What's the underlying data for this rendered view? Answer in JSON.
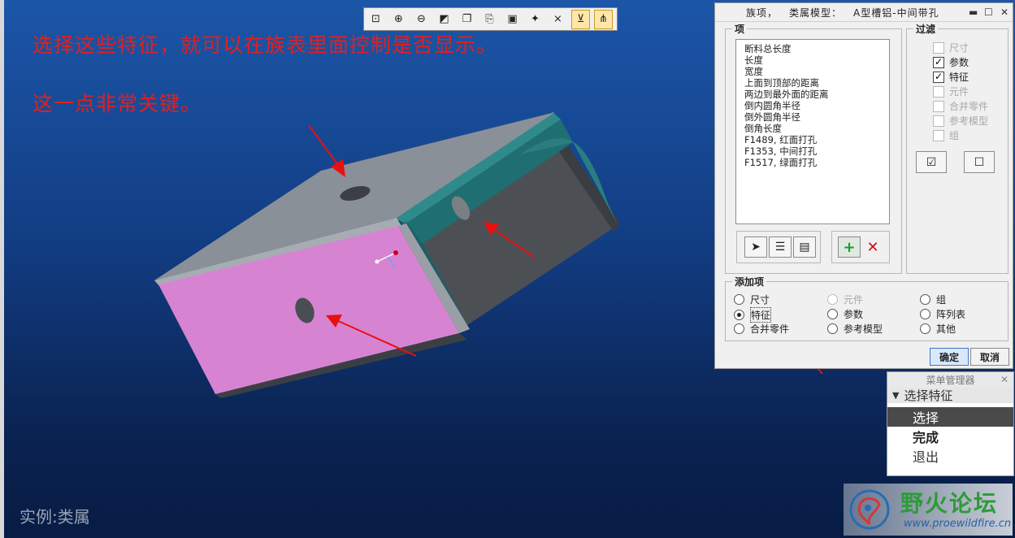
{
  "captions": {
    "line1": "选择这些特征，就可以在族表里面控制是否显示。",
    "line2": "这一点非常关键。",
    "instance_label": "实例:类属"
  },
  "toolbar": {
    "icons": [
      "zoom-fit-icon",
      "zoom-in-icon",
      "zoom-out-icon",
      "repaint-icon",
      "orientation-icon",
      "saved-views-icon",
      "layers-icon",
      "spin-center-icon",
      "datum-planes-icon",
      "datum-axes-icon",
      "datum-points-icon"
    ]
  },
  "dialog": {
    "title_part1": "族项，",
    "title_part2": "类属模型：",
    "title_part3": "A型槽铝-中间带孔",
    "items_label": "项",
    "items": [
      "断料总长度",
      "长度",
      "宽度",
      "上面到顶部的距离",
      "两边到最外面的距离",
      "倒内圆角半径",
      "倒外圆角半径",
      "倒角长度",
      "F1489, 红面打孔",
      "F1353, 中间打孔",
      "F1517, 绿面打孔"
    ],
    "filter_label": "过滤",
    "filters": [
      {
        "label": "尺寸",
        "checked": false,
        "enabled": false
      },
      {
        "label": "参数",
        "checked": true,
        "enabled": true
      },
      {
        "label": "特征",
        "checked": true,
        "enabled": true
      },
      {
        "label": "元件",
        "checked": false,
        "enabled": false
      },
      {
        "label": "合并零件",
        "checked": false,
        "enabled": false
      },
      {
        "label": "参考模型",
        "checked": false,
        "enabled": false
      },
      {
        "label": "组",
        "checked": false,
        "enabled": false
      }
    ],
    "add_item_label": "添加项",
    "add_options": [
      {
        "label": "尺寸",
        "selected": false,
        "enabled": true
      },
      {
        "label": "元件",
        "selected": false,
        "enabled": false
      },
      {
        "label": "组",
        "selected": false,
        "enabled": true
      },
      {
        "label": "特征",
        "selected": true,
        "enabled": true
      },
      {
        "label": "参数",
        "selected": false,
        "enabled": true
      },
      {
        "label": "阵列表",
        "selected": false,
        "enabled": true
      },
      {
        "label": "合并零件",
        "selected": false,
        "enabled": true
      },
      {
        "label": "参考模型",
        "selected": false,
        "enabled": true
      },
      {
        "label": "其他",
        "selected": false,
        "enabled": true
      }
    ],
    "ok_label": "确定",
    "cancel_label": "取消"
  },
  "menu_manager": {
    "title": "菜单管理器",
    "header": "选择特征",
    "items": [
      {
        "label": "选择",
        "selected": true
      },
      {
        "label": "完成",
        "bold": true
      },
      {
        "label": "退出"
      }
    ]
  },
  "watermark": {
    "name": "野火论坛",
    "url": "www.proewildfire.cn"
  },
  "colors": {
    "background_top": "#1c56a8",
    "background_bottom": "#081c44",
    "annotation_red": "#e02020",
    "part_gray": "#8a9097",
    "part_dark": "#4c5055",
    "part_teal": "#1f6e72",
    "selected_face": "#d684d2",
    "ok_button": "#d9e8fb"
  }
}
